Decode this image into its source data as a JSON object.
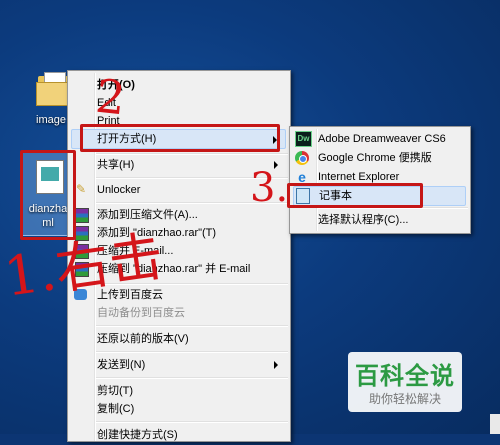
{
  "desktop": {
    "icons": [
      {
        "label": "image"
      },
      {
        "label": "dianzhao.html"
      }
    ]
  },
  "context_menu": {
    "items": [
      {
        "label": "打开(O)"
      },
      {
        "label": "Edit"
      },
      {
        "label": "Print"
      },
      {
        "label": "打开方式(H)"
      },
      {
        "label": "共享(H)"
      },
      {
        "label": "Unlocker"
      },
      {
        "label": "添加到压缩文件(A)..."
      },
      {
        "label": "添加到 \"dianzhao.rar\"(T)"
      },
      {
        "label": "压缩并 E-mail..."
      },
      {
        "label": "压缩到 \"dianzhao.rar\" 并 E-mail"
      },
      {
        "label": "上传到百度云"
      },
      {
        "label": "自动备份到百度云"
      },
      {
        "label": "还原以前的版本(V)"
      },
      {
        "label": "发送到(N)"
      },
      {
        "label": "剪切(T)"
      },
      {
        "label": "复制(C)"
      },
      {
        "label": "创建快捷方式(S)"
      }
    ]
  },
  "open_with_submenu": {
    "items": [
      {
        "label": "Adobe Dreamweaver CS6",
        "icon": "dreamweaver-icon"
      },
      {
        "label": "Google Chrome 便携版",
        "icon": "chrome-icon"
      },
      {
        "label": "Internet Explorer",
        "icon": "ie-icon"
      },
      {
        "label": "记事本",
        "icon": "notepad-icon"
      },
      {
        "label": "选择默认程序(C)..."
      }
    ]
  },
  "annotations": {
    "step1": "1.右击",
    "step2": "2",
    "step3": "3."
  },
  "watermark": {
    "title": "百科全说",
    "subtitle": "助你轻松解决"
  },
  "colors": {
    "annotation_red": "#c51616",
    "watermark_green": "#2c9a43",
    "highlight": "#d8e6f7"
  }
}
